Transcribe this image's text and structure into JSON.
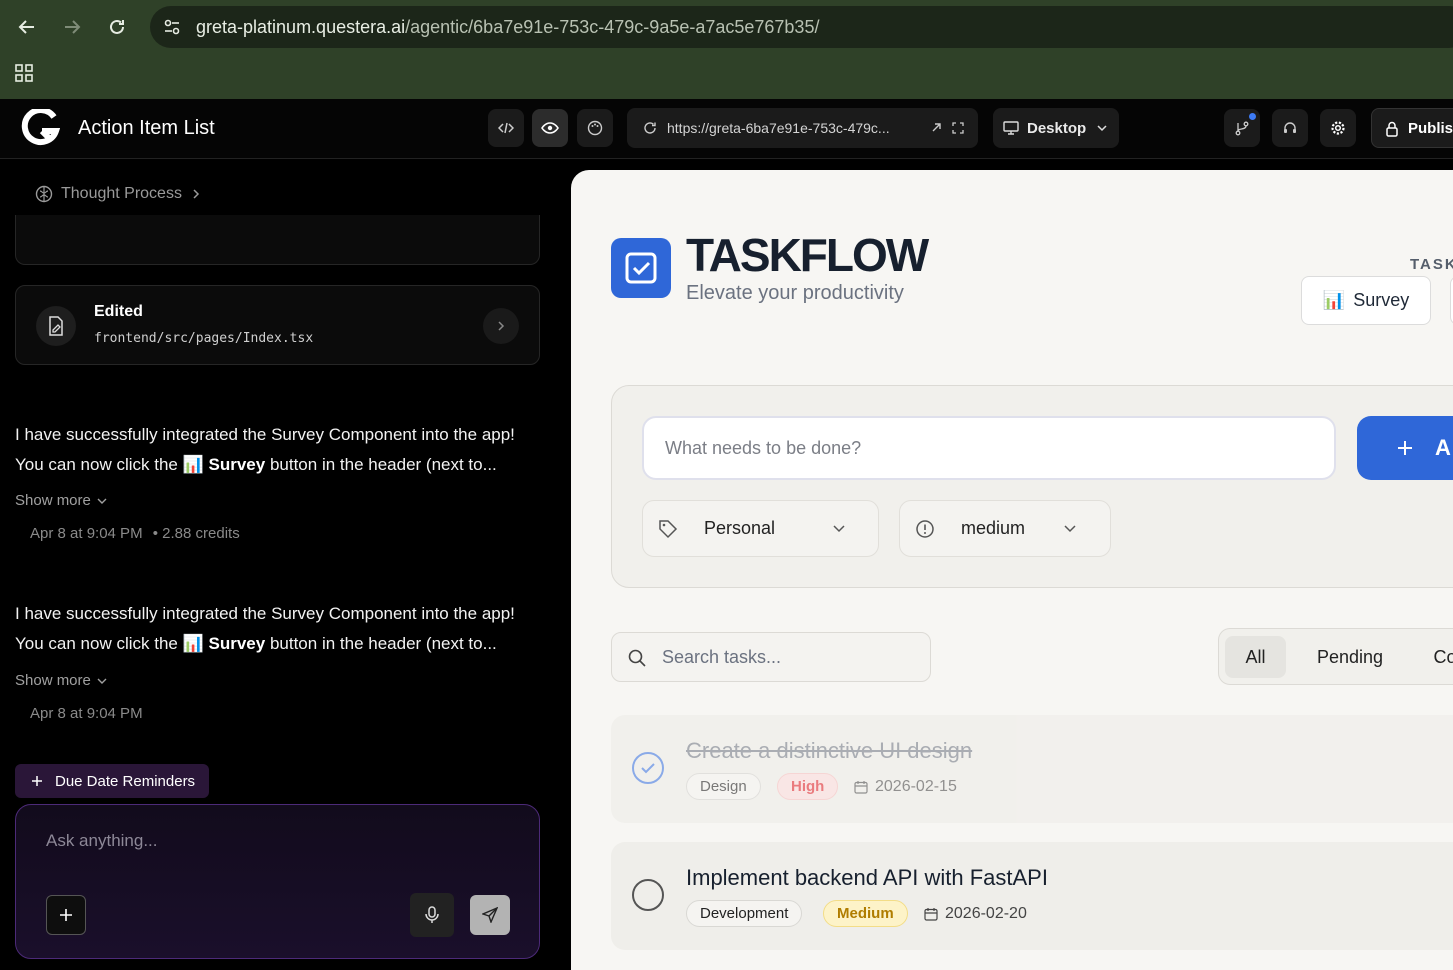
{
  "browser": {
    "url_host": "greta-platinum.questera.ai",
    "url_path": "/agentic/6ba7e91e-753c-479c-9a5e-a7ac5e767b35/"
  },
  "appbar": {
    "title": "Action Item List",
    "preview_url": "https://greta-6ba7e91e-753c-479c...",
    "device": "Desktop",
    "publish": "Publish"
  },
  "chat": {
    "thought_process": "Thought Process",
    "edited_title": "Edited",
    "edited_path": "frontend/src/pages/Index.tsx",
    "messages": [
      {
        "line1": "I have successfully integrated the Survey Component into the app!",
        "line2_pre": "You can now click the",
        "emoji": "📊",
        "line2_bold": "Survey",
        "line2_post": "button in the header (next to...",
        "show_more": "Show more",
        "time": "Apr 8 at 9:04 PM",
        "credits": "• 2.88 credits"
      },
      {
        "line1": "I have successfully integrated the Survey Component into the app!",
        "line2_pre": "You can now click the",
        "emoji": "📊",
        "line2_bold": "Survey",
        "line2_post": "button in the header (next to...",
        "show_more": "Show more",
        "time": "Apr 8 at 9:04 PM",
        "credits": ""
      }
    ],
    "suggestion_chip": "Due Date Reminders",
    "composer_placeholder": "Ask anything..."
  },
  "preview": {
    "brand": "TASKFLOW",
    "tagline": "Elevate your productivity",
    "task_label": "TASK",
    "survey_button": "Survey",
    "survey_emoji": "📊",
    "input_placeholder": "What needs to be done?",
    "add_button": "A",
    "category": "Personal",
    "priority": "medium",
    "search_placeholder": "Search tasks...",
    "filters": [
      "All",
      "Pending",
      "Co"
    ],
    "tasks": [
      {
        "title": "Create a distinctive UI design",
        "category": "Design",
        "priority": "High",
        "due": "2026-02-15",
        "done": true
      },
      {
        "title": "Implement backend API with FastAPI",
        "category": "Development",
        "priority": "Medium",
        "due": "2026-02-20",
        "done": false
      }
    ]
  },
  "colors": {
    "browser_chrome": "#2f4128",
    "accent_blue": "#2f67d8",
    "composer_border": "#4c2a78",
    "high_priority": "#e5484d",
    "medium_priority": "#b07d00"
  }
}
